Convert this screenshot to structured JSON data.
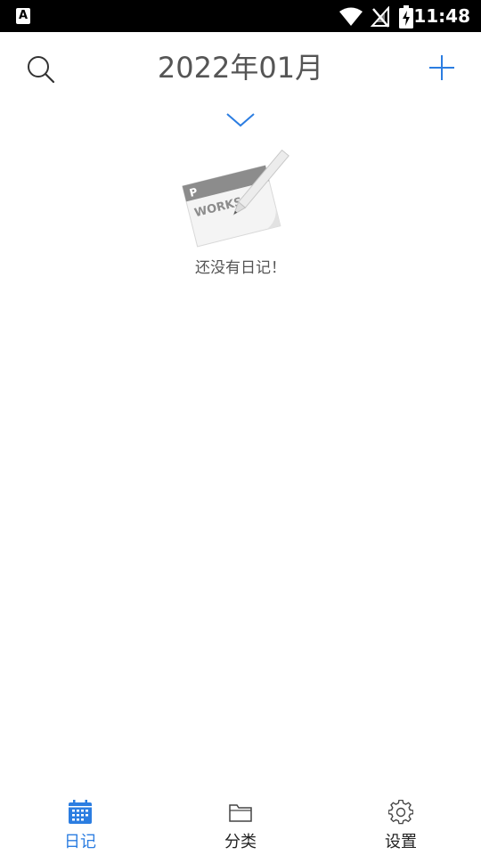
{
  "status_bar": {
    "left_icon": "A",
    "time": "11:48",
    "icons": [
      "wifi-icon",
      "no-signal-icon",
      "battery-charging-icon"
    ]
  },
  "header": {
    "title": "2022年01月",
    "search_icon": "search-icon",
    "add_icon": "plus-icon",
    "expand_icon": "chevron-down-icon"
  },
  "empty_state": {
    "illustration_text": "WORKS",
    "illustration_badge": "P",
    "message": "还没有日记！"
  },
  "bottom_nav": {
    "items": [
      {
        "label": "日记",
        "icon": "calendar-icon",
        "active": true
      },
      {
        "label": "分类",
        "icon": "folder-icon",
        "active": false
      },
      {
        "label": "设置",
        "icon": "gear-icon",
        "active": false
      }
    ]
  },
  "colors": {
    "accent": "#2b7de1",
    "title_text": "#555555",
    "nav_text": "#222222",
    "status_bar_bg": "#000000"
  }
}
